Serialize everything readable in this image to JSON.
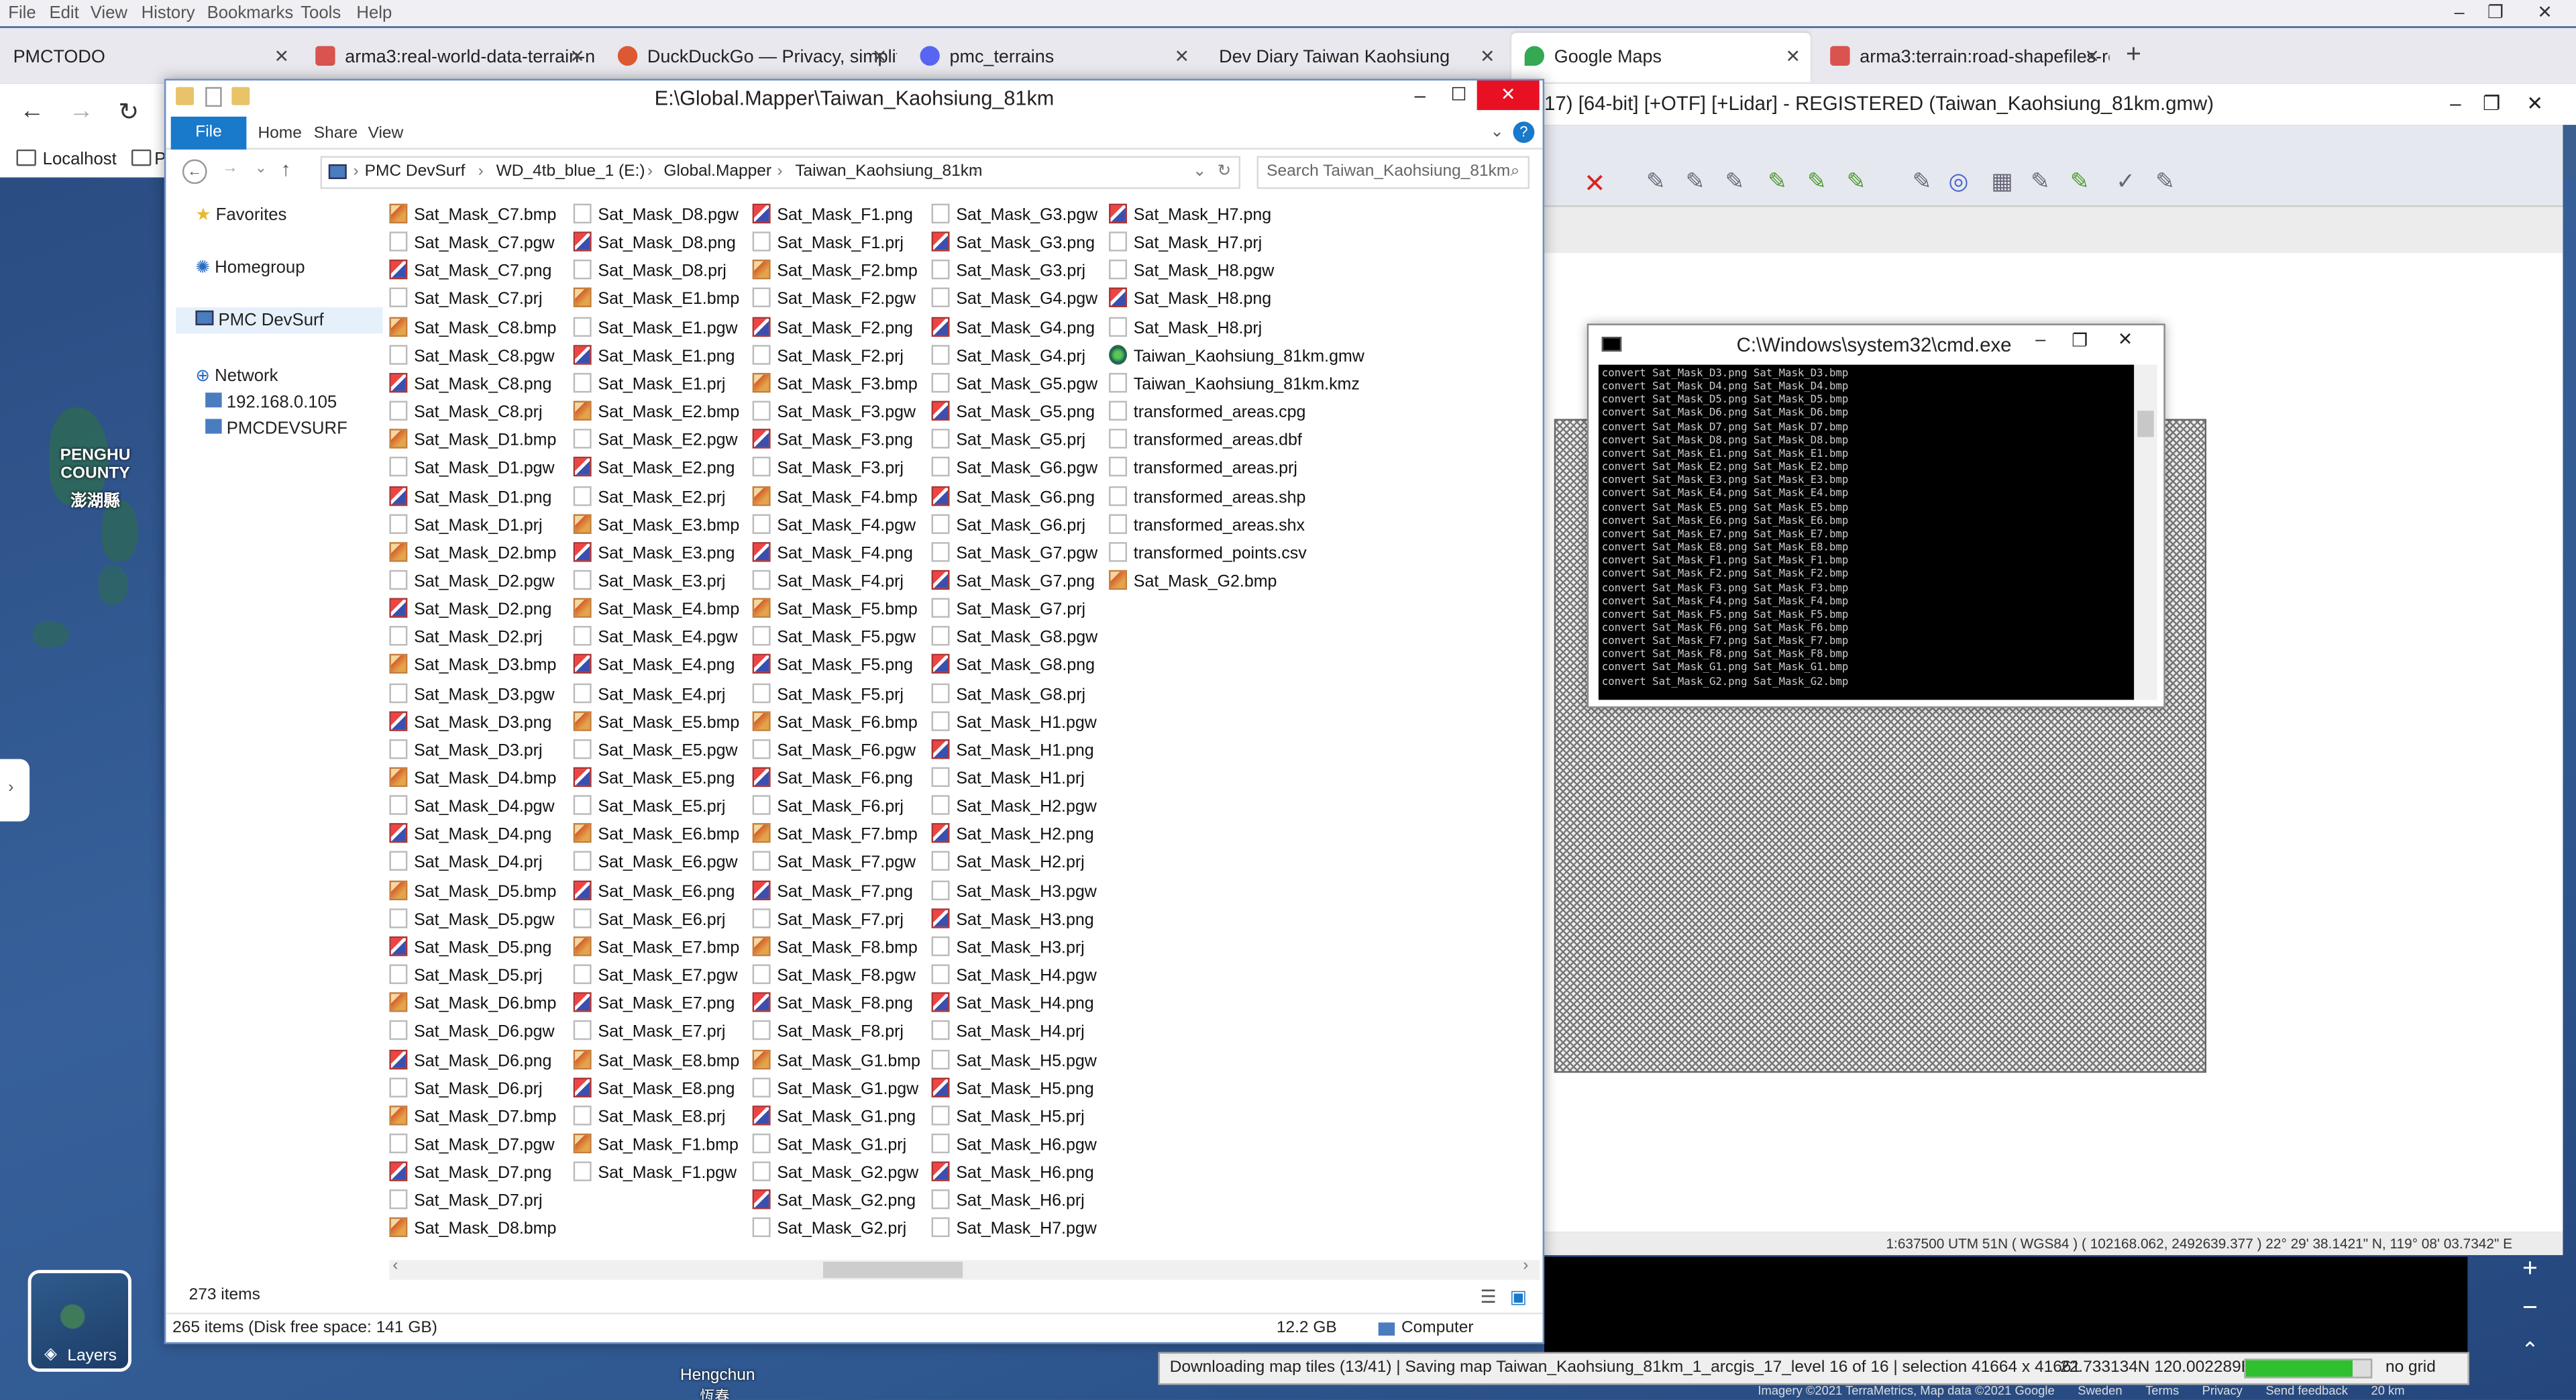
{
  "firefox": {
    "menu": [
      "File",
      "Edit",
      "View",
      "History",
      "Bookmarks",
      "Tools",
      "Help"
    ],
    "tabs": [
      {
        "label": "PMCTODO",
        "color": "#ffffff"
      },
      {
        "label": "arma3:real-world-data-terrain-n",
        "color": "#d9534f"
      },
      {
        "label": "DuckDuckGo — Privacy, simplifi",
        "color": "#de5833"
      },
      {
        "label": "pmc_terrains",
        "color": "#5865f2"
      },
      {
        "label": "Dev Diary Taiwan Kaohsiung",
        "color": "#ffffff"
      },
      {
        "label": "Google Maps",
        "color": "#34a853"
      },
      {
        "label": "arma3:terrain:road-shapefiles-re",
        "color": "#d9534f"
      }
    ],
    "bookmarks": [
      "Localhost",
      "P"
    ]
  },
  "map": {
    "region_label": "PENGHU\nCOUNTY",
    "region_label_cn": "澎湖縣",
    "town_label": "Hengchun",
    "town_label_cn": "恆春",
    "layers_label": "Layers",
    "footer": [
      "Imagery ©2021 TerraMetrics, Map data ©2021 Google",
      "Sweden",
      "Terms",
      "Privacy",
      "Send feedback",
      "20 km"
    ]
  },
  "global_mapper": {
    "title": "17) [64-bit] [+OTF] [+Lidar] - REGISTERED (Taiwan_Kaohsiung_81km.gmw)",
    "status": "1:637500 UTM 51N ( WGS84 ) ( 102168.062, 2492639.377 ) 22° 29' 38.1421\" N, 119° 08' 03.7342\" E",
    "bottom_status": "Downloading map tiles (13/41) | Saving map Taiwan_Kaohsiung_81km_1_arcgis_17_level 16 of 16 | selection 41664 x 41661",
    "coords": "22.733134N 120.002289E",
    "progress": 0.85,
    "grid": "no grid"
  },
  "cmd": {
    "title": "C:\\Windows\\system32\\cmd.exe",
    "lines": [
      "convert Sat_Mask_D3.png Sat_Mask_D3.bmp",
      "convert Sat_Mask_D4.png Sat_Mask_D4.bmp",
      "convert Sat_Mask_D5.png Sat_Mask_D5.bmp",
      "convert Sat_Mask_D6.png Sat_Mask_D6.bmp",
      "convert Sat_Mask_D7.png Sat_Mask_D7.bmp",
      "convert Sat_Mask_D8.png Sat_Mask_D8.bmp",
      "convert Sat_Mask_E1.png Sat_Mask_E1.bmp",
      "convert Sat_Mask_E2.png Sat_Mask_E2.bmp",
      "convert Sat_Mask_E3.png Sat_Mask_E3.bmp",
      "convert Sat_Mask_E4.png Sat_Mask_E4.bmp",
      "convert Sat_Mask_E5.png Sat_Mask_E5.bmp",
      "convert Sat_Mask_E6.png Sat_Mask_E6.bmp",
      "convert Sat_Mask_E7.png Sat_Mask_E7.bmp",
      "convert Sat_Mask_E8.png Sat_Mask_E8.bmp",
      "convert Sat_Mask_F1.png Sat_Mask_F1.bmp",
      "convert Sat_Mask_F2.png Sat_Mask_F2.bmp",
      "convert Sat_Mask_F3.png Sat_Mask_F3.bmp",
      "convert Sat_Mask_F4.png Sat_Mask_F4.bmp",
      "convert Sat_Mask_F5.png Sat_Mask_F5.bmp",
      "convert Sat_Mask_F6.png Sat_Mask_F6.bmp",
      "convert Sat_Mask_F7.png Sat_Mask_F7.bmp",
      "convert Sat_Mask_F8.png Sat_Mask_F8.bmp",
      "convert Sat_Mask_G1.png Sat_Mask_G1.bmp",
      "convert Sat_Mask_G2.png Sat_Mask_G2.bmp"
    ]
  },
  "explorer": {
    "title": "E:\\Global.Mapper\\Taiwan_Kaohsiung_81km",
    "ribbon": {
      "file": "File",
      "home": "Home",
      "share": "Share",
      "view": "View"
    },
    "breadcrumb": [
      "PMC DevSurf",
      "WD_4tb_blue_1 (E:)",
      "Global.Mapper",
      "Taiwan_Kaohsiung_81km"
    ],
    "search_placeholder": "Search Taiwan_Kaohsiung_81km",
    "nav": {
      "favorites": "Favorites",
      "homegroup": "Homegroup",
      "pc": "PMC DevSurf",
      "network": "Network",
      "ip": "192.168.0.105",
      "host": "PMCDEVSURF"
    },
    "items_count": "273 items",
    "status_left": "265 items (Disk free space: 141 GB)",
    "status_size": "12.2 GB",
    "status_location": "Computer",
    "columns": [
      [
        "Sat_Mask_C7.bmp",
        "Sat_Mask_C7.pgw",
        "Sat_Mask_C7.png",
        "Sat_Mask_C7.prj",
        "Sat_Mask_C8.bmp",
        "Sat_Mask_C8.pgw",
        "Sat_Mask_C8.png",
        "Sat_Mask_C8.prj",
        "Sat_Mask_D1.bmp",
        "Sat_Mask_D1.pgw",
        "Sat_Mask_D1.png",
        "Sat_Mask_D1.prj",
        "Sat_Mask_D2.bmp",
        "Sat_Mask_D2.pgw",
        "Sat_Mask_D2.png",
        "Sat_Mask_D2.prj",
        "Sat_Mask_D3.bmp",
        "Sat_Mask_D3.pgw",
        "Sat_Mask_D3.png",
        "Sat_Mask_D3.prj",
        "Sat_Mask_D4.bmp",
        "Sat_Mask_D4.pgw",
        "Sat_Mask_D4.png",
        "Sat_Mask_D4.prj",
        "Sat_Mask_D5.bmp",
        "Sat_Mask_D5.pgw",
        "Sat_Mask_D5.png",
        "Sat_Mask_D5.prj",
        "Sat_Mask_D6.bmp",
        "Sat_Mask_D6.pgw",
        "Sat_Mask_D6.png",
        "Sat_Mask_D6.prj",
        "Sat_Mask_D7.bmp",
        "Sat_Mask_D7.pgw",
        "Sat_Mask_D7.png",
        "Sat_Mask_D7.prj",
        "Sat_Mask_D8.bmp"
      ],
      [
        "Sat_Mask_D8.pgw",
        "Sat_Mask_D8.png",
        "Sat_Mask_D8.prj",
        "Sat_Mask_E1.bmp",
        "Sat_Mask_E1.pgw",
        "Sat_Mask_E1.png",
        "Sat_Mask_E1.prj",
        "Sat_Mask_E2.bmp",
        "Sat_Mask_E2.pgw",
        "Sat_Mask_E2.png",
        "Sat_Mask_E2.prj",
        "Sat_Mask_E3.bmp",
        "Sat_Mask_E3.png",
        "Sat_Mask_E3.prj",
        "Sat_Mask_E4.bmp",
        "Sat_Mask_E4.pgw",
        "Sat_Mask_E4.png",
        "Sat_Mask_E4.prj",
        "Sat_Mask_E5.bmp",
        "Sat_Mask_E5.pgw",
        "Sat_Mask_E5.png",
        "Sat_Mask_E5.prj",
        "Sat_Mask_E6.bmp",
        "Sat_Mask_E6.pgw",
        "Sat_Mask_E6.png",
        "Sat_Mask_E6.prj",
        "Sat_Mask_E7.bmp",
        "Sat_Mask_E7.pgw",
        "Sat_Mask_E7.png",
        "Sat_Mask_E7.prj",
        "Sat_Mask_E8.bmp",
        "Sat_Mask_E8.png",
        "Sat_Mask_E8.prj",
        "Sat_Mask_F1.bmp",
        "Sat_Mask_F1.pgw"
      ],
      [
        "Sat_Mask_F1.png",
        "Sat_Mask_F1.prj",
        "Sat_Mask_F2.bmp",
        "Sat_Mask_F2.pgw",
        "Sat_Mask_F2.png",
        "Sat_Mask_F2.prj",
        "Sat_Mask_F3.bmp",
        "Sat_Mask_F3.pgw",
        "Sat_Mask_F3.png",
        "Sat_Mask_F3.prj",
        "Sat_Mask_F4.bmp",
        "Sat_Mask_F4.pgw",
        "Sat_Mask_F4.png",
        "Sat_Mask_F4.prj",
        "Sat_Mask_F5.bmp",
        "Sat_Mask_F5.pgw",
        "Sat_Mask_F5.png",
        "Sat_Mask_F5.prj",
        "Sat_Mask_F6.bmp",
        "Sat_Mask_F6.pgw",
        "Sat_Mask_F6.png",
        "Sat_Mask_F6.prj",
        "Sat_Mask_F7.bmp",
        "Sat_Mask_F7.pgw",
        "Sat_Mask_F7.png",
        "Sat_Mask_F7.prj",
        "Sat_Mask_F8.bmp",
        "Sat_Mask_F8.pgw",
        "Sat_Mask_F8.png",
        "Sat_Mask_F8.prj",
        "Sat_Mask_G1.bmp",
        "Sat_Mask_G1.pgw",
        "Sat_Mask_G1.png",
        "Sat_Mask_G1.prj",
        "Sat_Mask_G2.pgw",
        "Sat_Mask_G2.png",
        "Sat_Mask_G2.prj"
      ],
      [
        "Sat_Mask_G3.pgw",
        "Sat_Mask_G3.png",
        "Sat_Mask_G3.prj",
        "Sat_Mask_G4.pgw",
        "Sat_Mask_G4.png",
        "Sat_Mask_G4.prj",
        "Sat_Mask_G5.pgw",
        "Sat_Mask_G5.png",
        "Sat_Mask_G5.prj",
        "Sat_Mask_G6.pgw",
        "Sat_Mask_G6.png",
        "Sat_Mask_G6.prj",
        "Sat_Mask_G7.pgw",
        "Sat_Mask_G7.png",
        "Sat_Mask_G7.prj",
        "Sat_Mask_G8.pgw",
        "Sat_Mask_G8.png",
        "Sat_Mask_G8.prj",
        "Sat_Mask_H1.pgw",
        "Sat_Mask_H1.png",
        "Sat_Mask_H1.prj",
        "Sat_Mask_H2.pgw",
        "Sat_Mask_H2.png",
        "Sat_Mask_H2.prj",
        "Sat_Mask_H3.pgw",
        "Sat_Mask_H3.png",
        "Sat_Mask_H3.prj",
        "Sat_Mask_H4.pgw",
        "Sat_Mask_H4.png",
        "Sat_Mask_H4.prj",
        "Sat_Mask_H5.pgw",
        "Sat_Mask_H5.png",
        "Sat_Mask_H5.prj",
        "Sat_Mask_H6.pgw",
        "Sat_Mask_H6.png",
        "Sat_Mask_H6.prj",
        "Sat_Mask_H7.pgw"
      ],
      [
        "Sat_Mask_H7.png",
        "Sat_Mask_H7.prj",
        "Sat_Mask_H8.pgw",
        "Sat_Mask_H8.png",
        "Sat_Mask_H8.prj",
        "Taiwan_Kaohsiung_81km.gmw",
        "Taiwan_Kaohsiung_81km.kmz",
        "transformed_areas.cpg",
        "transformed_areas.dbf",
        "transformed_areas.prj",
        "transformed_areas.shp",
        "transformed_areas.shx",
        "transformed_points.csv",
        "Sat_Mask_G2.bmp"
      ]
    ]
  }
}
